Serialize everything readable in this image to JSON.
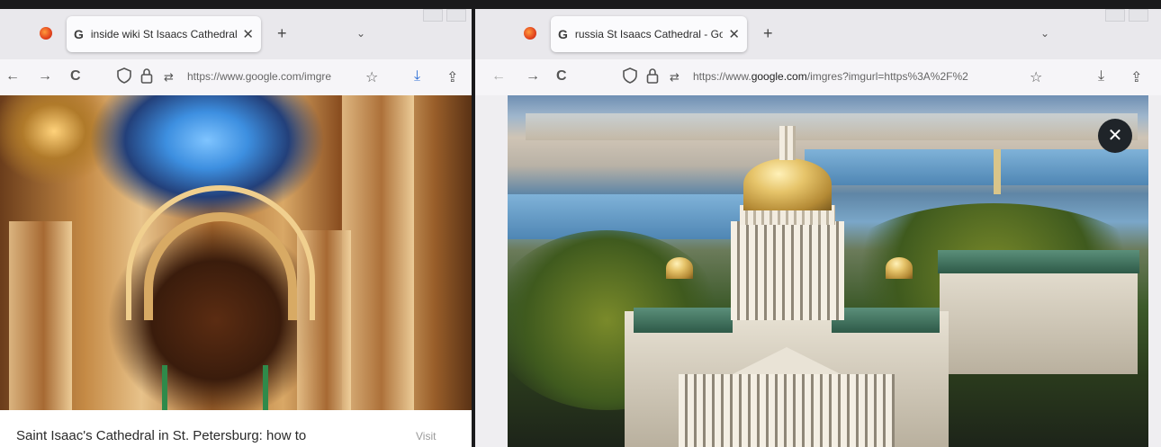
{
  "left_window": {
    "tab_title": "inside wiki St Isaacs Cathedral -",
    "url": "https://www.google.com/imgre",
    "caption": "Saint Isaac's Cathedral in St. Petersburg: how to",
    "visit_label": "Visit"
  },
  "right_window": {
    "tab_title": "russia St Isaacs Cathedral - Goo",
    "url_prefix": "https://www.",
    "url_domain": "google.com",
    "url_rest": "/imgres?imgurl=https%3A%2F%2",
    "close_label": "✕"
  },
  "icons": {
    "back": "←",
    "forward": "→",
    "reload": "C",
    "shield": "shield-icon",
    "lock": "lock-icon",
    "star": "☆",
    "download": "⤓",
    "share": "⇪",
    "new_tab": "+",
    "tab_close": "✕",
    "tab_list": "⌄",
    "google": "G"
  },
  "colors": {
    "firefox_orange": "#e2431e",
    "download_blue": "#2f6fd6",
    "tab_bg": "#fbfbfd",
    "overlay_close_bg": "#1f2429"
  }
}
